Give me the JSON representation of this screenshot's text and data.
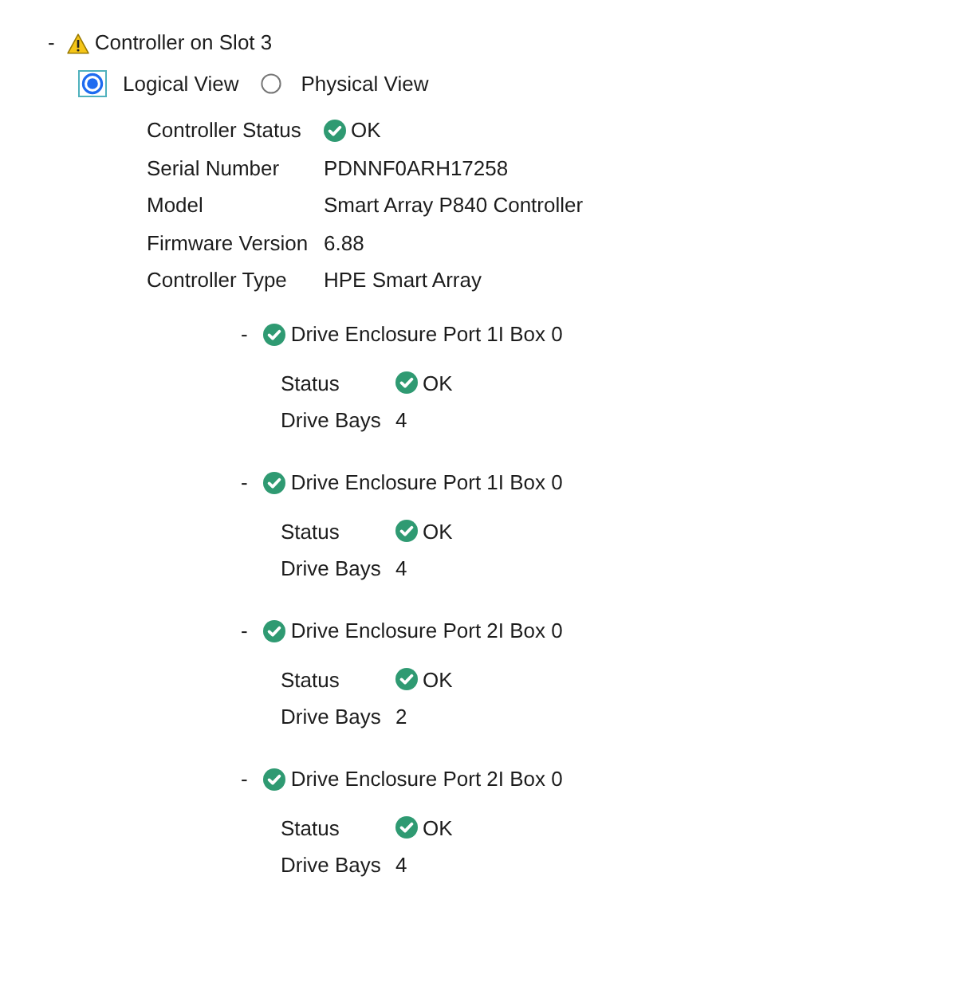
{
  "controller": {
    "toggle": "-",
    "kind": "warning",
    "title": "Controller on Slot 3",
    "views": [
      {
        "label": "Logical View",
        "selected": true,
        "focused": true
      },
      {
        "label": "Physical View",
        "selected": false,
        "focused": false
      }
    ],
    "properties": [
      {
        "kind": "status",
        "label": "Controller Status",
        "value": "OK"
      },
      {
        "kind": "text",
        "label": "Serial Number",
        "value": "PDNNF0ARH17258"
      },
      {
        "kind": "text",
        "label": "Model",
        "value": "Smart Array P840 Controller"
      },
      {
        "kind": "text",
        "label": "Firmware Version",
        "value": "6.88"
      },
      {
        "kind": "text",
        "label": "Controller Type",
        "value": "HPE Smart Array"
      }
    ],
    "enclosures": [
      {
        "toggle": "-",
        "kind": "ok",
        "title": "Drive Enclosure Port 1I Box 0",
        "properties": [
          {
            "kind": "status",
            "label": "Status",
            "value": "OK"
          },
          {
            "kind": "text",
            "label": "Drive Bays",
            "value": "4"
          }
        ]
      },
      {
        "toggle": "-",
        "kind": "ok",
        "title": "Drive Enclosure Port 1I Box 0",
        "properties": [
          {
            "kind": "status",
            "label": "Status",
            "value": "OK"
          },
          {
            "kind": "text",
            "label": "Drive Bays",
            "value": "4"
          }
        ]
      },
      {
        "toggle": "-",
        "kind": "ok",
        "title": "Drive Enclosure Port 2I Box 0",
        "properties": [
          {
            "kind": "status",
            "label": "Status",
            "value": "OK"
          },
          {
            "kind": "text",
            "label": "Drive Bays",
            "value": "2"
          }
        ]
      },
      {
        "toggle": "-",
        "kind": "ok",
        "title": "Drive Enclosure Port 2I Box 0",
        "properties": [
          {
            "kind": "status",
            "label": "Status",
            "value": "OK"
          },
          {
            "kind": "text",
            "label": "Drive Bays",
            "value": "4"
          }
        ]
      }
    ]
  }
}
